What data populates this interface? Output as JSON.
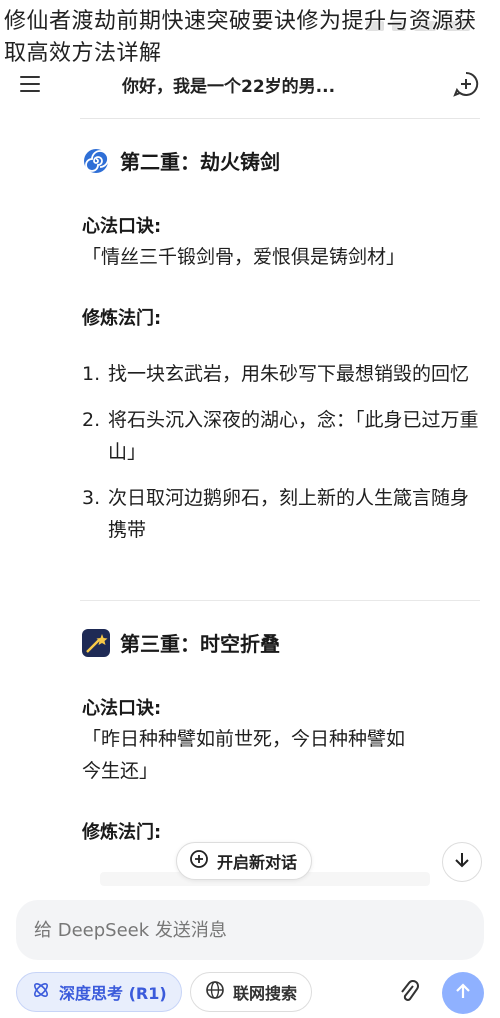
{
  "overlay": {
    "title": "修仙者渡劫前期快速突破要诀修为提升与资源获取高效方法详解"
  },
  "header": {
    "title": "你好，我是一个22岁的男..."
  },
  "sections": [
    {
      "title": "第二重：劫火铸剑",
      "mantra_label": "心法口诀:",
      "mantra": "「情丝三千锻剑骨，爱恨俱是铸剑材」",
      "method_label": "修炼法门:",
      "steps": [
        {
          "num": "1.",
          "text": "找一块玄武岩，用朱砂写下最想销毁的回忆"
        },
        {
          "num": "2.",
          "text": "将石头沉入深夜的湖心，念：「此身已过万重山」"
        },
        {
          "num": "3.",
          "text": "次日取河边鹅卵石，刻上新的人生箴言随身携带"
        }
      ]
    },
    {
      "title": "第三重：时空折叠",
      "mantra_label": "心法口诀:",
      "mantra_line1": "「昨日种种譬如前世死，今日种种譬如",
      "mantra_line2": "今生还」",
      "method_label": "修炼法门:"
    }
  ],
  "floating": {
    "new_chat_label": "开启新对话"
  },
  "input": {
    "placeholder": "给 DeepSeek 发送消息"
  },
  "toolbar": {
    "deep_think_label": "深度思考 (R1)",
    "web_search_label": "联网搜索"
  },
  "colors": {
    "accent": "#3b5bdb",
    "send_button": "#8fb1ff",
    "section2_icon": "#2f6fd6",
    "section3_icon": "#1e2a55"
  }
}
